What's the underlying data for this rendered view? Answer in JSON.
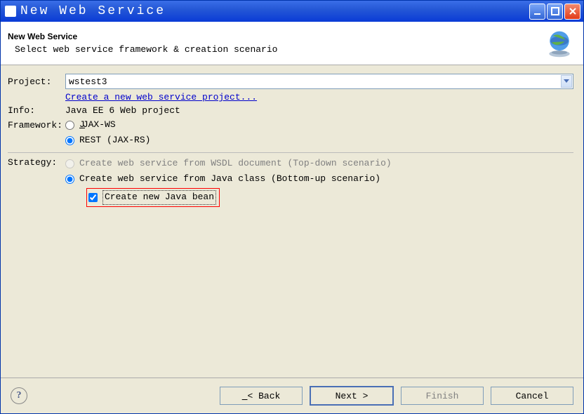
{
  "window": {
    "title": "New Web Service"
  },
  "header": {
    "title": "New Web Service",
    "subtitle": "Select web service framework & creation scenario"
  },
  "form": {
    "projectLabel": "Project:",
    "projectValue": "wstest3",
    "newProjectLink": "Create a new web service project...",
    "infoLabel": "Info:",
    "infoValue": "Java EE 6 Web project",
    "frameworkLabel": "Framework:",
    "radioJaxWs": "JAX-WS",
    "radioRest": "REST (JAX-RS)",
    "strategyLabel": "Strategy:",
    "radioTopDown": "Create web service from WSDL document (Top-down scenario)",
    "radioBottomUp": "Create web service from Java class (Bottom-up scenario)",
    "checkNewBean": "Create new Java bean"
  },
  "buttons": {
    "back": "< Back",
    "next": "Next >",
    "finish": "Finish",
    "cancel": "Cancel"
  },
  "state": {
    "frameworkSelected": "rest",
    "strategySelected": "bottomup",
    "topdownEnabled": false,
    "newBeanChecked": true,
    "finishEnabled": false
  }
}
